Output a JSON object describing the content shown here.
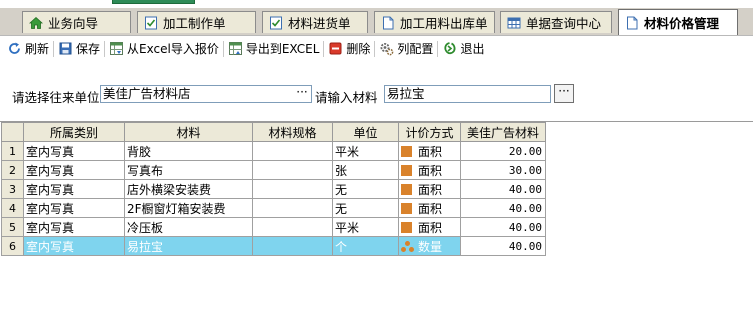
{
  "tabs": [
    {
      "label": "业务向导",
      "icon": "home-icon",
      "active": false
    },
    {
      "label": "加工制作单",
      "icon": "checklist-icon",
      "active": false
    },
    {
      "label": "材料进货单",
      "icon": "checklist-icon",
      "active": false
    },
    {
      "label": "加工用料出库单",
      "icon": "document-icon",
      "active": false
    },
    {
      "label": "单据查询中心",
      "icon": "table-icon",
      "active": false
    },
    {
      "label": "材料价格管理",
      "icon": "document-icon",
      "active": true
    }
  ],
  "toolbar": {
    "refresh": "刷新",
    "save": "保存",
    "import_excel": "从Excel导入报价",
    "export_excel": "导出到EXCEL",
    "delete": "删除",
    "column_config": "列配置",
    "exit": "退出"
  },
  "filter": {
    "supplier_label": "请选择往来单位",
    "supplier_value": "美佳广告材料店",
    "material_label": "请输入材料",
    "material_value": "易拉宝",
    "ellipsis": "···"
  },
  "grid": {
    "columns": [
      "所属类别",
      "材料",
      "材料规格",
      "单位",
      "计价方式",
      "美佳广告材料"
    ],
    "rows": [
      {
        "no": "1",
        "category": "室内写真",
        "material": "背胶",
        "spec": "",
        "unit": "平米",
        "pricing": "面积",
        "price": "20.00"
      },
      {
        "no": "2",
        "category": "室内写真",
        "material": "写真布",
        "spec": "",
        "unit": "张",
        "pricing": "面积",
        "price": "30.00"
      },
      {
        "no": "3",
        "category": "室内写真",
        "material": "店外横梁安装费",
        "spec": "",
        "unit": "无",
        "pricing": "面积",
        "price": "40.00"
      },
      {
        "no": "4",
        "category": "室内写真",
        "material": "2F橱窗灯箱安装费",
        "spec": "",
        "unit": "无",
        "pricing": "面积",
        "price": "40.00"
      },
      {
        "no": "5",
        "category": "室内写真",
        "material": "冷压板",
        "spec": "",
        "unit": "平米",
        "pricing": "面积",
        "price": "40.00"
      },
      {
        "no": "6",
        "category": "室内写真",
        "material": "易拉宝",
        "spec": "",
        "unit": "个",
        "pricing": "数量",
        "price": "40.00"
      }
    ],
    "selected_row": "6"
  },
  "colors": {
    "selected_row": "#7fd4ee",
    "pricing_marker": "#d9822b",
    "header_bg": "#ece9d8"
  }
}
